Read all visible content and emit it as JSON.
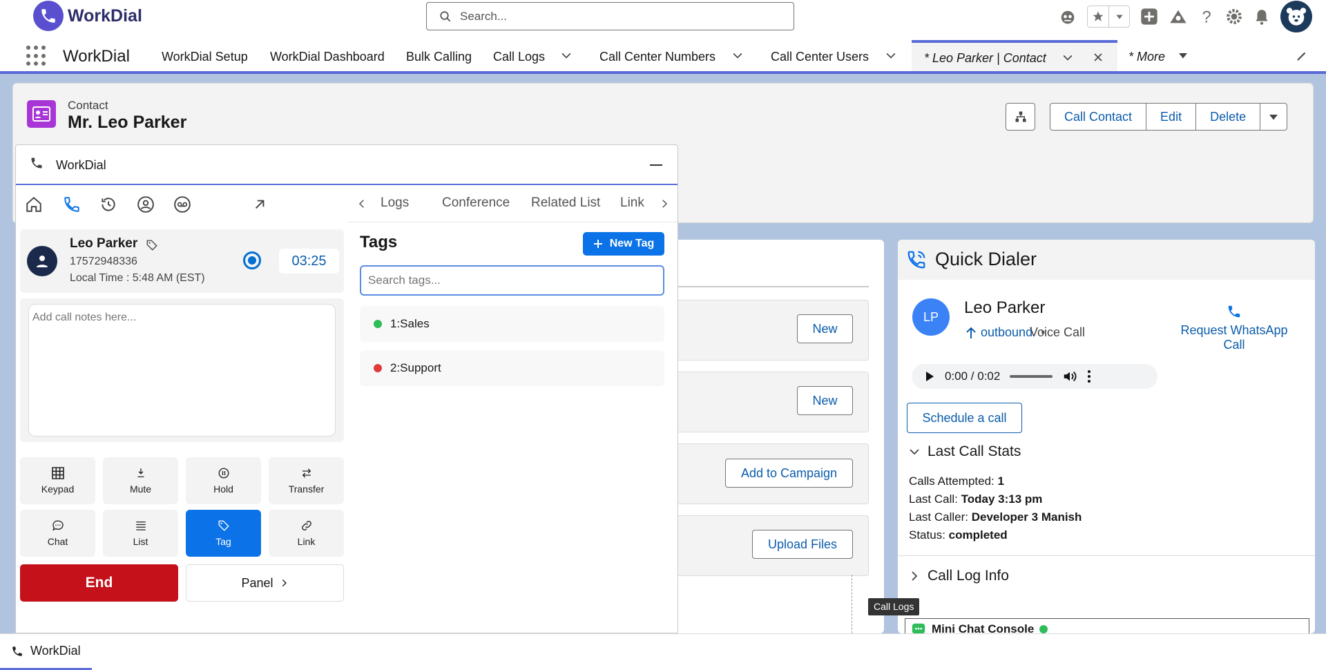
{
  "header": {
    "brand": "WorkDial",
    "search_placeholder": "Search..."
  },
  "nav": {
    "app_name": "WorkDial",
    "items": [
      {
        "label": "WorkDial Setup"
      },
      {
        "label": "WorkDial Dashboard"
      },
      {
        "label": "Bulk Calling"
      },
      {
        "label": "Call Logs"
      },
      {
        "label": "Call Center Numbers"
      },
      {
        "label": "Call Center Users"
      }
    ],
    "active_tab": "* Leo Parker | Contact",
    "more": "* More"
  },
  "record": {
    "type": "Contact",
    "name": "Mr. Leo Parker",
    "actions": [
      "Call Contact",
      "Edit",
      "Delete"
    ]
  },
  "middle": {
    "buttons": [
      "New",
      "New",
      "Add to Campaign",
      "Upload Files"
    ]
  },
  "quick_dialer": {
    "title": "Quick Dialer",
    "initials": "LP",
    "name": "Leo Parker",
    "direction": "outbound",
    "separator": "•",
    "call_type": "Voice Call",
    "whatsapp": "Request WhatsApp Call",
    "audio_time": "0:00 / 0:02",
    "schedule": "Schedule a call",
    "stats_title": "Last Call Stats",
    "stats": [
      {
        "label": "Calls Attempted:",
        "value": "1"
      },
      {
        "label": "Last Call:",
        "value": "Today 3:13 pm"
      },
      {
        "label": "Last Caller:",
        "value": "Developer 3 Manish"
      },
      {
        "label": "Status:",
        "value": "completed"
      }
    ],
    "call_log_info": "Call Log Info",
    "tooltip": "Call Logs",
    "chat_console": "Mini Chat Console"
  },
  "widget": {
    "title": "WorkDial",
    "tabs": [
      "Logs",
      "Conference",
      "Related List",
      "Link"
    ],
    "caller": {
      "name": "Leo Parker",
      "number": "17572948336",
      "local_time": "Local Time : 5:48 AM (EST)",
      "timer": "03:25"
    },
    "notes_placeholder": "Add call notes here...",
    "controls": [
      "Keypad",
      "Mute",
      "Hold",
      "Transfer",
      "Chat",
      "List",
      "Tag",
      "Link"
    ],
    "end": "End",
    "panel": "Panel",
    "tags": {
      "title": "Tags",
      "new_tag": "New Tag",
      "search_placeholder": "Search tags...",
      "items": [
        {
          "label": "1:Sales",
          "color": "#2ebd59"
        },
        {
          "label": "2:Support",
          "color": "#e03b3b"
        }
      ]
    }
  },
  "bottom_bar": {
    "label": "WorkDial"
  },
  "colors": {
    "brand": "#5a4fcf",
    "accent": "#0b72e7",
    "end": "#c4111a"
  }
}
